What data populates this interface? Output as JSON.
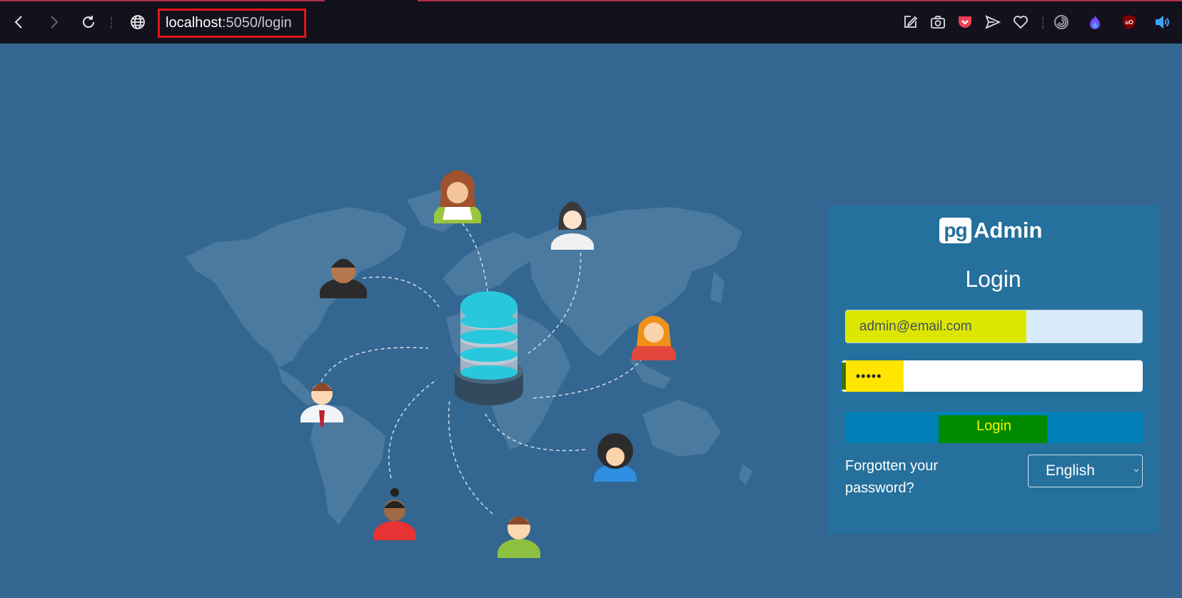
{
  "browser": {
    "url_host": "localhost",
    "url_rest": ":5050/login",
    "icons": [
      "back-icon",
      "forward-icon",
      "reload-icon",
      "globe-icon",
      "pencil-square-icon",
      "camera-icon",
      "pocket-icon",
      "send-icon",
      "heart-icon",
      "spiral-icon",
      "flame-icon",
      "ublock-icon",
      "speaker-icon"
    ]
  },
  "login": {
    "logo_pg": "pg",
    "logo_admin": "Admin",
    "title": "Login",
    "email_value": "admin@email.com",
    "password_value": "•••••",
    "button_label": "Login",
    "forgot_label": "Forgotten your password?",
    "language": "English"
  },
  "colors": {
    "background": "#336691",
    "card": "#25709c",
    "button": "#0080b6",
    "highlight_yellow": "#ffe500",
    "highlight_green": "#008a00",
    "url_border": "#e2161b"
  }
}
